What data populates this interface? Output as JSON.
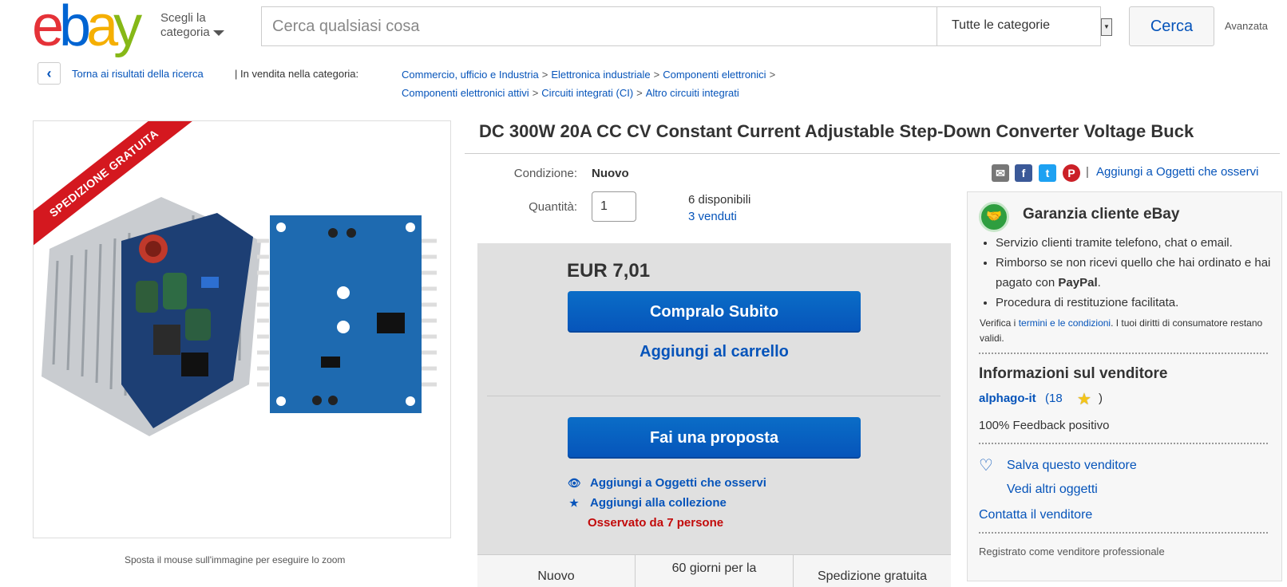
{
  "header": {
    "logo": [
      "e",
      "b",
      "a",
      "y"
    ],
    "logo_colors": [
      "#e53238",
      "#0064d2",
      "#f5af02",
      "#86b817"
    ],
    "shop_by_line1": "Scegli la",
    "shop_by_line2": "categoria",
    "search_placeholder": "Cerca qualsiasi cosa",
    "category_value": "Tutte le categorie",
    "search_button": "Cerca",
    "advanced": "Avanzata"
  },
  "breadcrumb": {
    "back_label": "Torna ai risultati della ricerca",
    "listed_in": "| In vendita nella categoria:",
    "line1": [
      "Commercio, ufficio e Industria",
      "Elettronica industriale",
      "Componenti elettronici"
    ],
    "line2": [
      "Componenti elettronici attivi",
      "Circuiti integrati (CI)",
      "Altro circuiti integrati"
    ],
    "separator": ">"
  },
  "image_panel": {
    "ribbon": "SPEDIZIONE GRATUITA",
    "zoom_hint": "Sposta il mouse sull'immagine per eseguire lo zoom"
  },
  "product": {
    "title": "DC 300W 20A CC CV Constant Current Adjustable Step-Down Converter Voltage Buck",
    "condition_label": "Condizione:",
    "condition_value": "Nuovo",
    "quantity_label": "Quantità:",
    "quantity_value": "1",
    "available": "6 disponibili",
    "sold": "3 venduti"
  },
  "buy_box": {
    "price": "EUR 7,01",
    "buy_now": "Compralo Subito",
    "add_to_cart": "Aggiungi al carrello",
    "make_offer": "Fai una proposta",
    "watch": "Aggiungi a Oggetti che osservi",
    "collection": "Aggiungi alla collezione",
    "watchers": "Osservato da 7 persone",
    "strip": [
      "Nuovo",
      "60 giorni per la",
      "Spedizione gratuita"
    ]
  },
  "share": {
    "separator": "|",
    "watch_link": "Aggiungi a Oggetti che osservi"
  },
  "sidebar": {
    "guarantee_title": "Garanzia cliente eBay",
    "guarantee_items": [
      "Servizio clienti tramite telefono, chat o email.",
      "Rimborso se non ricevi quello che hai ordinato e hai pagato con",
      "Procedura di restituzione facilitata."
    ],
    "paypal": "PayPal",
    "note_pre": "Verifica i ",
    "note_link": "termini e le condizioni",
    "note_post": ". I tuoi diritti di consumatore restano validi.",
    "seller_heading": "Informazioni sul venditore",
    "seller_name": "alphago-it",
    "seller_score": "(18",
    "seller_close": ")",
    "feedback": "100% Feedback positivo",
    "save_seller": "Salva questo venditore",
    "see_items": "Vedi altri oggetti",
    "contact": "Contatta il venditore",
    "registered": "Registrato come venditore professionale"
  }
}
